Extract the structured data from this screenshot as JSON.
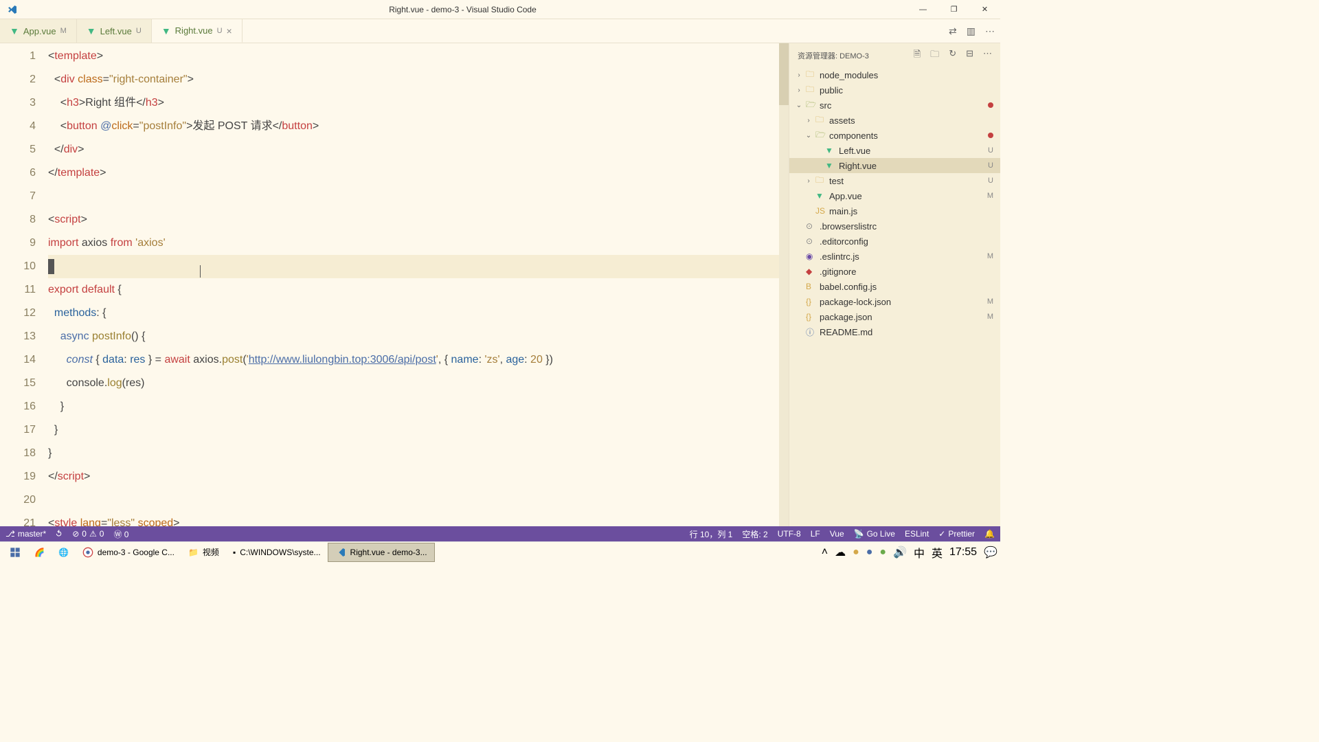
{
  "window": {
    "title": "Right.vue - demo-3 - Visual Studio Code",
    "controls": {
      "minimize": "—",
      "maximize": "❐",
      "close": "✕"
    }
  },
  "tabs": [
    {
      "name": "App.vue",
      "status": "M"
    },
    {
      "name": "Left.vue",
      "status": "U"
    },
    {
      "name": "Right.vue",
      "status": "U",
      "active": true
    }
  ],
  "editor_actions": {
    "compare": "⇄",
    "split": "▥",
    "more": "⋯"
  },
  "sidebar": {
    "title": "资源管理器: DEMO-3",
    "actions": [
      "new-file",
      "new-folder",
      "refresh",
      "collapse",
      "more"
    ],
    "tree": [
      {
        "indent": 0,
        "chev": "›",
        "icon": "folder",
        "name": "node_modules",
        "status": ""
      },
      {
        "indent": 0,
        "chev": "›",
        "icon": "folder",
        "name": "public",
        "status": ""
      },
      {
        "indent": 0,
        "chev": "⌄",
        "icon": "folder-open",
        "name": "src",
        "status": "",
        "dot": "red"
      },
      {
        "indent": 1,
        "chev": "›",
        "icon": "folder",
        "name": "assets",
        "status": ""
      },
      {
        "indent": 1,
        "chev": "⌄",
        "icon": "folder-open",
        "name": "components",
        "status": "",
        "dot": "red"
      },
      {
        "indent": 2,
        "chev": "",
        "icon": "vue",
        "name": "Left.vue",
        "status": "U"
      },
      {
        "indent": 2,
        "chev": "",
        "icon": "vue",
        "name": "Right.vue",
        "status": "U",
        "active": true
      },
      {
        "indent": 1,
        "chev": "›",
        "icon": "folder",
        "name": "test",
        "status": "U"
      },
      {
        "indent": 1,
        "chev": "",
        "icon": "vue",
        "name": "App.vue",
        "status": "M"
      },
      {
        "indent": 1,
        "chev": "",
        "icon": "js",
        "name": "main.js",
        "status": ""
      },
      {
        "indent": 0,
        "chev": "",
        "icon": "config",
        "name": ".browserslistrc",
        "status": ""
      },
      {
        "indent": 0,
        "chev": "",
        "icon": "config",
        "name": ".editorconfig",
        "status": ""
      },
      {
        "indent": 0,
        "chev": "",
        "icon": "eslint",
        "name": ".eslintrc.js",
        "status": "M"
      },
      {
        "indent": 0,
        "chev": "",
        "icon": "git",
        "name": ".gitignore",
        "status": ""
      },
      {
        "indent": 0,
        "chev": "",
        "icon": "babel",
        "name": "babel.config.js",
        "status": ""
      },
      {
        "indent": 0,
        "chev": "",
        "icon": "json",
        "name": "package-lock.json",
        "status": "M"
      },
      {
        "indent": 0,
        "chev": "",
        "icon": "json",
        "name": "package.json",
        "status": "M"
      },
      {
        "indent": 0,
        "chev": "",
        "icon": "md",
        "name": "README.md",
        "status": ""
      }
    ]
  },
  "status": {
    "branch": "master*",
    "sync": "↻",
    "errors": "0",
    "warnings": "0",
    "port": "Ⓦ 0",
    "position": "行 10，列 1",
    "spaces": "空格: 2",
    "encoding": "UTF-8",
    "eol": "LF",
    "language": "Vue",
    "golive": "Go Live",
    "eslint": "ESLint",
    "prettier": "Prettier",
    "bell": "🔔"
  },
  "taskbar": {
    "items": [
      {
        "icon": "win",
        "label": ""
      },
      {
        "icon": "rainbow",
        "label": ""
      },
      {
        "icon": "edge",
        "label": ""
      },
      {
        "icon": "chrome",
        "label": "demo-3 - Google C..."
      },
      {
        "icon": "folder",
        "label": "视频"
      },
      {
        "icon": "cmd",
        "label": "C:\\WINDOWS\\syste..."
      },
      {
        "icon": "vscode",
        "label": "Right.vue - demo-3...",
        "active": true
      }
    ],
    "tray": {
      "ime1": "中",
      "ime2": "英",
      "time": "17:55"
    }
  },
  "code": {
    "lines": 21,
    "l1": {
      "a": "<",
      "b": "template",
      "c": ">"
    },
    "l2": {
      "a": "  <",
      "b": "div",
      "c": " ",
      "d": "class",
      "e": "=",
      "f": "\"right-container\"",
      "g": ">"
    },
    "l3": {
      "a": "    <",
      "b": "h3",
      "c": ">",
      "d": "Right 组件",
      "e": "</",
      "f": "h3",
      "g": ">"
    },
    "l4": {
      "a": "    <",
      "b": "button",
      "c": " ",
      "d": "@",
      "e": "click",
      "f": "=",
      "g": "\"postInfo\"",
      "h": ">",
      "i": "发起 POST 请求",
      "j": "</",
      "k": "button",
      "l": ">"
    },
    "l5": {
      "a": "  </",
      "b": "div",
      "c": ">"
    },
    "l6": {
      "a": "</",
      "b": "template",
      "c": ">"
    },
    "l8": {
      "a": "<",
      "b": "script",
      "c": ">"
    },
    "l9": {
      "a": "import",
      "b": " axios ",
      "c": "from",
      "d": " ",
      "e": "'axios'"
    },
    "l11": {
      "a": "export",
      "b": " ",
      "c": "default",
      "d": " {"
    },
    "l12": {
      "a": "  methods",
      "b": ": {"
    },
    "l13": {
      "a": "    ",
      "b": "async",
      "c": " ",
      "d": "postInfo",
      "e": "() {"
    },
    "l14": {
      "a": "      ",
      "b": "const",
      "c": " { ",
      "d": "data",
      "e": ": ",
      "f": "res",
      "g": " } = ",
      "h": "await",
      "i": " axios.",
      "j": "post",
      "k": "(",
      "l": "'",
      "m": "http://www.liulongbin.top:3006/api/post",
      "n": "'",
      "o": ", { ",
      "p": "name",
      "q": ": ",
      "r": "'zs'",
      "s": ", ",
      "t": "age",
      "u": ": ",
      "v": "20",
      "w": " })"
    },
    "l15": {
      "a": "      console.",
      "b": "log",
      "c": "(res)"
    },
    "l16": {
      "a": "    }"
    },
    "l17": {
      "a": "  }"
    },
    "l18": {
      "a": "}"
    },
    "l19": {
      "a": "</",
      "b": "script",
      "c": ">"
    },
    "l21": {
      "a": "<",
      "b": "style",
      "c": " ",
      "d": "lang",
      "e": "=",
      "f": "\"less\"",
      "g": " ",
      "h": "scoped",
      "i": ">"
    }
  }
}
